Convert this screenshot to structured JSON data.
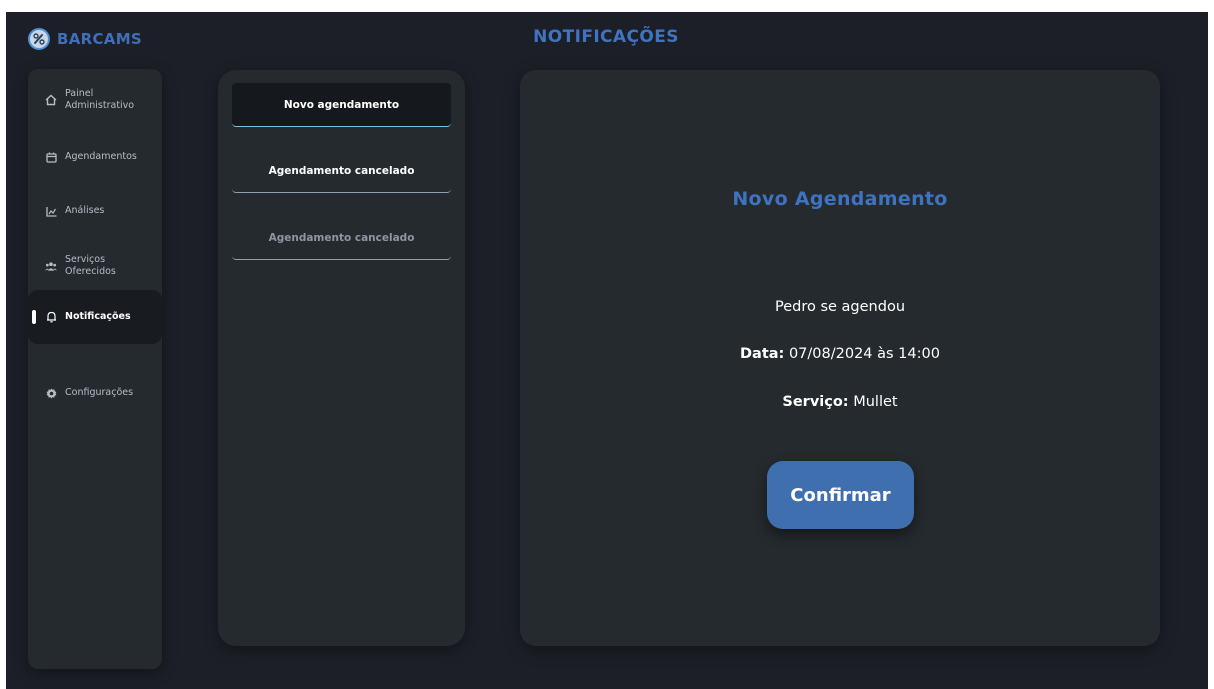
{
  "brand": {
    "name": "BARCAMS"
  },
  "header": {
    "title": "NOTIFICAÇÕES"
  },
  "sidebar": {
    "items": [
      {
        "label": "Painel Administrativo",
        "icon": "home-icon"
      },
      {
        "label": "Agendamentos",
        "icon": "calendar-icon"
      },
      {
        "label": "Análises",
        "icon": "chart-icon"
      },
      {
        "label": "Serviços Oferecidos",
        "icon": "users-icon"
      },
      {
        "label": "Notificações",
        "icon": "bell-icon",
        "active": true
      },
      {
        "label": "Configurações",
        "icon": "gear-icon"
      }
    ]
  },
  "notifications": {
    "items": [
      {
        "label": "Novo agendamento",
        "selected": true
      },
      {
        "label": "Agendamento cancelado"
      },
      {
        "label": "Agendamento cancelado"
      }
    ]
  },
  "detail": {
    "title": "Novo Agendamento",
    "message": "Pedro se agendou",
    "date_label": "Data:",
    "date_value": "07/08/2024 às 14:00",
    "service_label": "Serviço:",
    "service_value": "Mullet",
    "confirm_label": "Confirmar"
  },
  "colors": {
    "background": "#1c1f27",
    "panel": "#252a2f",
    "accent": "#3f74c2",
    "button": "#3f6faf"
  }
}
